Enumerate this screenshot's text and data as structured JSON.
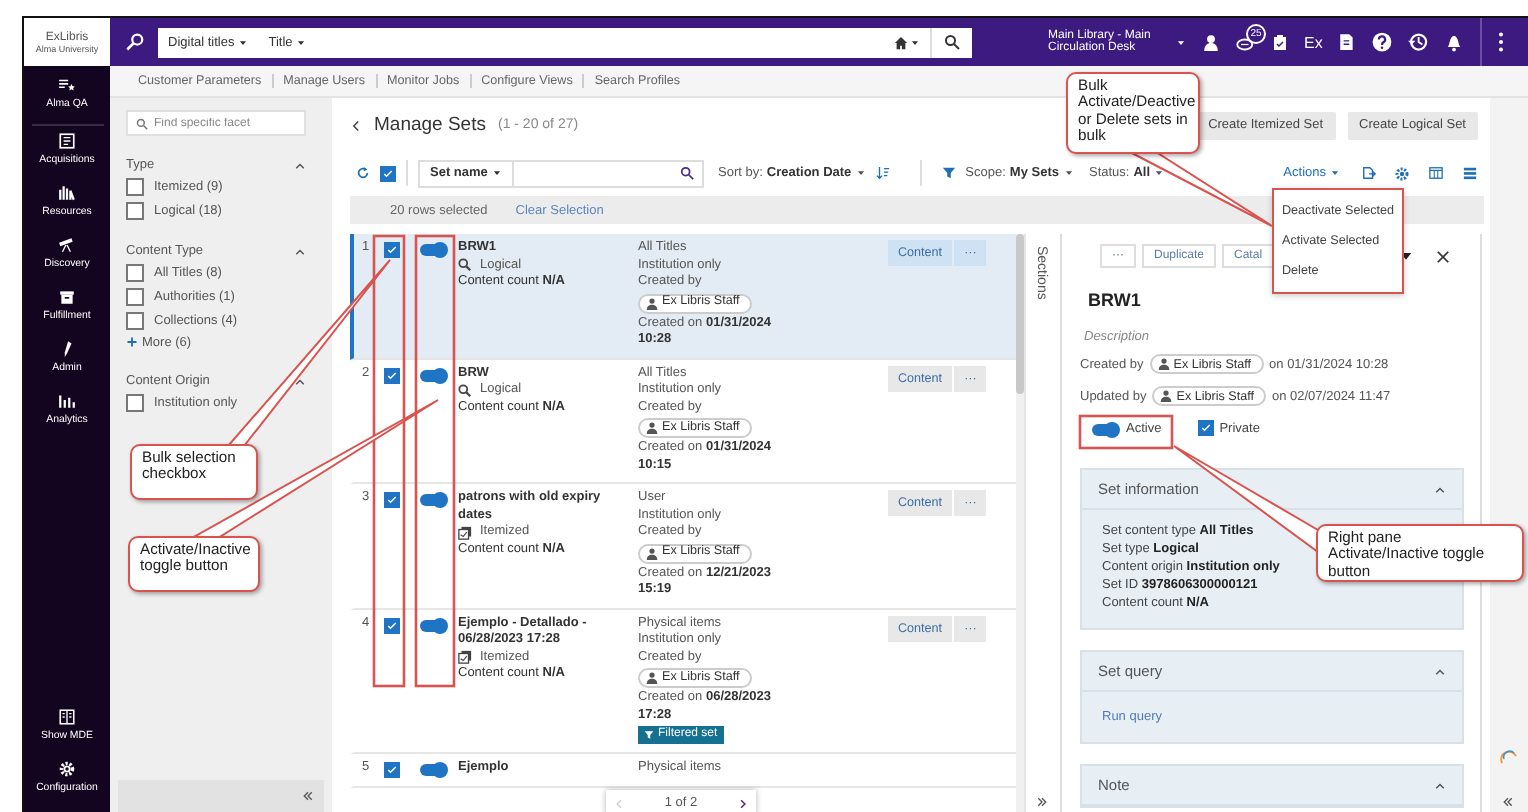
{
  "logo": {
    "name": "ExLibris",
    "subtitle": "Alma University"
  },
  "search": {
    "scope": "Digital titles",
    "field": "Title"
  },
  "location": "Main Library - Main Circulation Desk",
  "badge": "25",
  "ex_label": "Ex",
  "nav": [
    {
      "label": "Alma QA"
    },
    {
      "label": "Acquisitions"
    },
    {
      "label": "Resources"
    },
    {
      "label": "Discovery"
    },
    {
      "label": "Fulfillment"
    },
    {
      "label": "Admin"
    },
    {
      "label": "Analytics"
    }
  ],
  "nav_bottom": [
    {
      "label": "Show MDE"
    },
    {
      "label": "Configuration"
    }
  ],
  "submenu": [
    "Customer Parameters",
    "Manage Users",
    "Monitor Jobs",
    "Configure Views",
    "Search Profiles"
  ],
  "facets": {
    "placeholder": "Find specific facet",
    "groups": [
      {
        "title": "Type",
        "expanded": true,
        "options": [
          {
            "label": "Itemized (9)",
            "checked": false
          },
          {
            "label": "Logical (18)",
            "checked": false
          }
        ]
      },
      {
        "title": "Content Type",
        "expanded": true,
        "options": [
          {
            "label": "All Titles (8)",
            "checked": false
          },
          {
            "label": "Authorities (1)",
            "checked": false
          },
          {
            "label": "Collections (4)",
            "checked": false
          }
        ],
        "more": "More (6)"
      },
      {
        "title": "Content Origin",
        "expanded": true,
        "options": [
          {
            "label": "Institution only",
            "checked": false
          }
        ]
      }
    ]
  },
  "page": {
    "title": "Manage Sets",
    "count": "(1 - 20 of 27)"
  },
  "create_buttons": [
    "Create Itemized Set",
    "Create Logical Set"
  ],
  "toolbar": {
    "select_all_checked": true,
    "search_field": "Set name",
    "sort_label": "Sort by:",
    "sort_value": "Creation Date",
    "scope_label": "Scope:",
    "scope_value": "My Sets",
    "status_label": "Status:",
    "status_value": "All",
    "actions": "Actions"
  },
  "actions_menu": [
    "Deactivate Selected",
    "Activate Selected",
    "Delete"
  ],
  "selection": {
    "count": "20 rows selected",
    "clear": "Clear Selection"
  },
  "rows": [
    {
      "number": "1",
      "checked": true,
      "active": true,
      "selected": true,
      "name": "BRW1",
      "kind": "logical",
      "type": "Logical",
      "count_label": "Content count",
      "count": "N/A",
      "content_type": "All Titles",
      "origin": "Institution only",
      "created_by_label": "Created by",
      "creator": "Ex Libris Staff",
      "created_on_label": "Created on",
      "created_on": "01/31/2024",
      "created_time": "10:28",
      "content_button": "Content",
      "more_button": "···"
    },
    {
      "number": "2",
      "checked": true,
      "active": true,
      "selected": false,
      "name": "BRW",
      "kind": "logical",
      "type": "Logical",
      "count_label": "Content count",
      "count": "N/A",
      "content_type": "All Titles",
      "origin": "Institution only",
      "created_by_label": "Created by",
      "creator": "Ex Libris Staff",
      "created_on_label": "Created on",
      "created_on": "01/31/2024",
      "created_time": "10:15",
      "content_button": "Content",
      "more_button": "···"
    },
    {
      "number": "3",
      "checked": true,
      "active": true,
      "selected": false,
      "name": "patrons with old expiry dates",
      "kind": "itemized",
      "type": "Itemized",
      "count_label": "Content count",
      "count": "N/A",
      "content_type": "User",
      "origin": "Institution only",
      "created_by_label": "Created by",
      "creator": "Ex Libris Staff",
      "created_on_label": "Created on",
      "created_on": "12/21/2023",
      "created_time": "15:19",
      "content_button": "Content",
      "more_button": "···"
    },
    {
      "number": "4",
      "checked": true,
      "active": true,
      "selected": false,
      "name": "Ejemplo - Detallado - 06/28/2023 17:28",
      "kind": "itemized",
      "type": "Itemized",
      "count_label": "Content count",
      "count": "N/A",
      "content_type": "Physical items",
      "origin": "Institution only",
      "created_by_label": "Created by",
      "creator": "Ex Libris Staff",
      "created_on_label": "Created on",
      "created_on": "06/28/2023",
      "created_time": "17:28",
      "tag": "Filtered set",
      "content_button": "Content",
      "more_button": "···"
    },
    {
      "number": "5",
      "checked": true,
      "active": true,
      "selected": false,
      "name": "Ejemplo",
      "content_type": "Physical items"
    }
  ],
  "pagination": "1 of 2",
  "sections_label": "Sections",
  "detail": {
    "buttons": [
      "···",
      "Duplicate",
      "Catal"
    ],
    "title": "BRW1",
    "description": "Description",
    "created_by_label": "Created by",
    "creator": "Ex Libris Staff",
    "created_on": "on 01/31/2024 10:28",
    "updated_by_label": "Updated by",
    "updater": "Ex Libris Staff",
    "updated_on": "on 02/07/2024 11:47",
    "active": true,
    "active_label": "Active",
    "private": true,
    "private_label": "Private",
    "panels": [
      {
        "title": "Set information",
        "expanded": true,
        "kind": "fields",
        "fields": [
          {
            "label": "Set content type",
            "value": "All Titles"
          },
          {
            "label": "Set type",
            "value": "Logical"
          },
          {
            "label": "Content origin",
            "value": "Institution only"
          },
          {
            "label": "Set ID",
            "value": "3978606300000121"
          },
          {
            "label": "Content count",
            "value": "N/A"
          }
        ]
      },
      {
        "title": "Set query",
        "expanded": true,
        "kind": "link",
        "link": "Run query"
      },
      {
        "title": "Note",
        "expanded": true,
        "kind": "empty"
      }
    ]
  },
  "callouts": [
    {
      "text": "Bulk Activate/Deactive or Delete sets in bulk"
    },
    {
      "text": "Bulk selection checkbox"
    },
    {
      "text": "Activate/Inactive toggle button"
    },
    {
      "text": "Right pane Activate/Inactive toggle button"
    }
  ]
}
